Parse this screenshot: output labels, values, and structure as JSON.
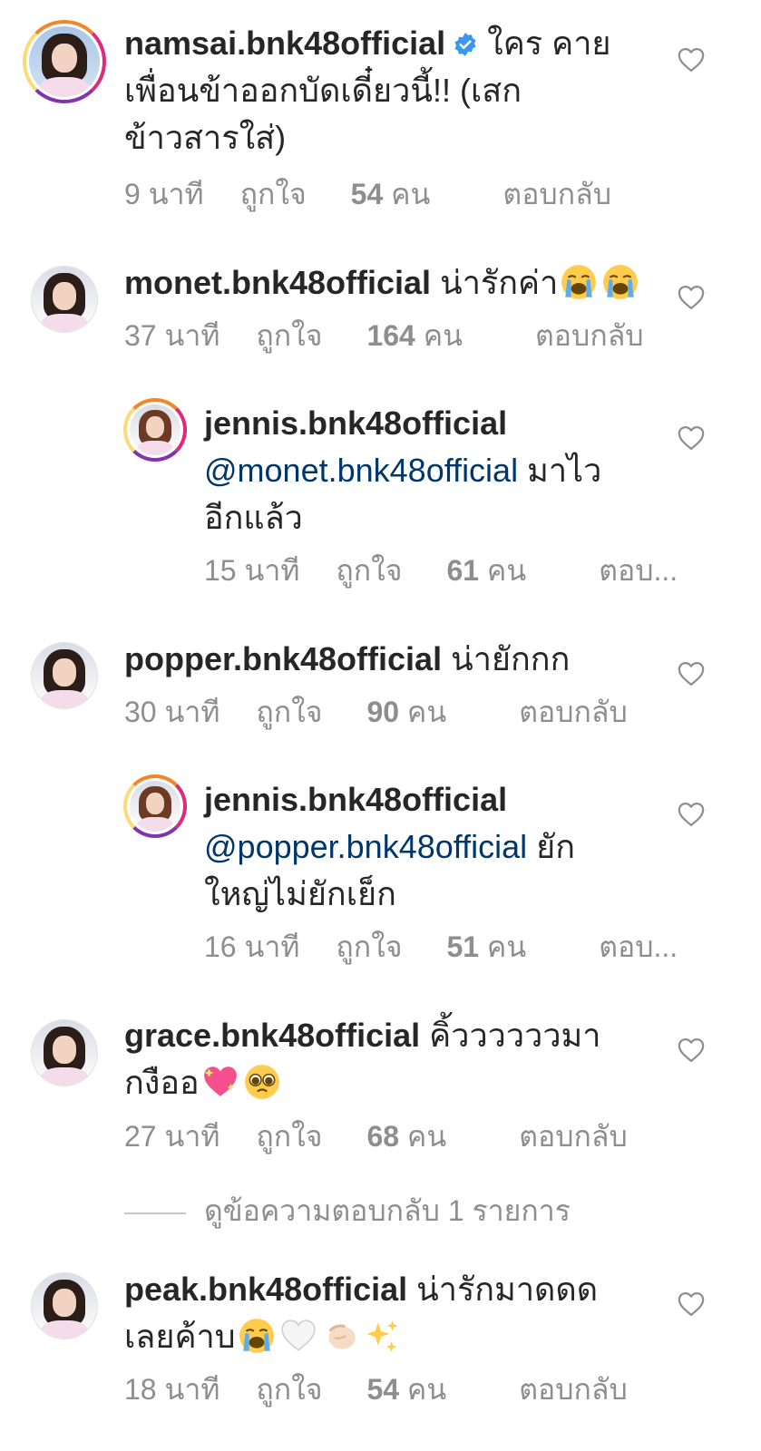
{
  "comments": [
    {
      "username": "namsai.bnk48official",
      "verified": true,
      "text": "ใคร คายเพื่อนข้าออกบัดเดี๋ยวนี้!! (เสกข้าวสารใส่)",
      "time": "9 นาที",
      "likes_prefix": "ถูกใจ",
      "likes_count": "54",
      "likes_suffix": "คน",
      "reply": "ตอบกลับ"
    },
    {
      "username": "monet.bnk48official",
      "text": "น่ารักค่า",
      "emojis": [
        "loudly-crying-face",
        "loudly-crying-face"
      ],
      "time": "37 นาที",
      "likes_prefix": "ถูกใจ",
      "likes_count": "164",
      "likes_suffix": "คน",
      "reply": "ตอบกลับ"
    },
    {
      "username": "jennis.bnk48official",
      "mention": "@monet.bnk48official",
      "text": "มาไวอีกแล้ว",
      "time": "15 นาที",
      "likes_prefix": "ถูกใจ",
      "likes_count": "61",
      "likes_suffix": "คน",
      "reply": "ตอบ..."
    },
    {
      "username": "popper.bnk48official",
      "text": "น่ายักกก",
      "time": "30 นาที",
      "likes_prefix": "ถูกใจ",
      "likes_count": "90",
      "likes_suffix": "คน",
      "reply": "ตอบกลับ"
    },
    {
      "username": "jennis.bnk48official",
      "mention": "@popper.bnk48official",
      "text": "ยักใหญ่ไม่ยักเย็ก",
      "time": "16 นาที",
      "likes_prefix": "ถูกใจ",
      "likes_count": "51",
      "likes_suffix": "คน",
      "reply": "ตอบ..."
    },
    {
      "username": "grace.bnk48official",
      "text": "คิ้ววววววมากงืออ",
      "emojis": [
        "sparkling-heart",
        "pleading-face"
      ],
      "time": "27 นาที",
      "likes_prefix": "ถูกใจ",
      "likes_count": "68",
      "likes_suffix": "คน",
      "reply": "ตอบกลับ"
    },
    {
      "username": "peak.bnk48official",
      "text": "น่ารักมาดดดเลยค้าบ",
      "emojis": [
        "loudly-crying-face",
        "white-heart",
        "pinching-hand",
        "sparkles"
      ],
      "time": "18 นาที",
      "likes_prefix": "ถูกใจ",
      "likes_count": "54",
      "likes_suffix": "คน",
      "reply": "ตอบกลับ"
    }
  ],
  "view_replies": "ดูข้อความตอบกลับ 1 รายการ",
  "icons": {
    "like": "heart-outline-icon",
    "verified": "verified-badge-icon"
  },
  "colors": {
    "text": "#262626",
    "secondary": "#8e8e8e",
    "mention": "#00376b",
    "verified": "#3897f0"
  }
}
